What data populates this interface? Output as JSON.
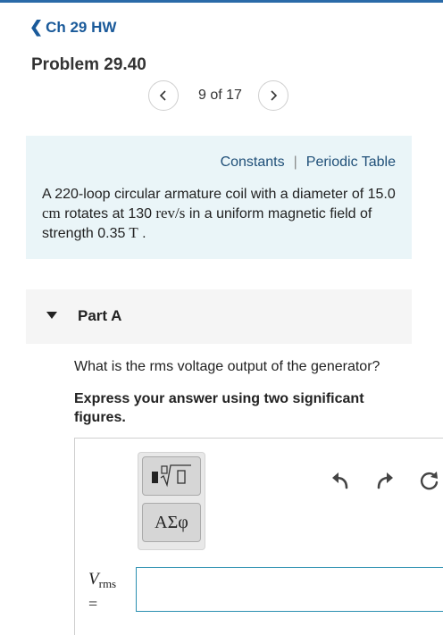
{
  "nav": {
    "back_label": "Ch 29 HW"
  },
  "problem": {
    "title": "Problem 29.40"
  },
  "pager": {
    "text": "9 of 17"
  },
  "resources": {
    "constants": "Constants",
    "separator": "|",
    "periodic_table": "Periodic Table"
  },
  "statement": {
    "t1": "A 220-loop circular armature coil with a diameter of 15.0",
    "u1": " cm",
    "t2": " rotates at 130",
    "u2": " rev/s",
    "t3": " in a uniform magnetic field of strength 0.35",
    "u3": " T",
    "t4": " ."
  },
  "part": {
    "title": "Part A",
    "question": "What is the rms voltage output of the generator?",
    "instruction": "Express your answer using two significant figures."
  },
  "toolbar": {
    "greek_label": "ΑΣφ"
  },
  "answer": {
    "var_symbol": "V",
    "var_subscript": "rms",
    "equals": "=",
    "value": "",
    "placeholder": ""
  },
  "colors": {
    "accent": "#1a5a9a",
    "info_bg": "#eaf5f8",
    "input_border": "#2a8fb0"
  }
}
